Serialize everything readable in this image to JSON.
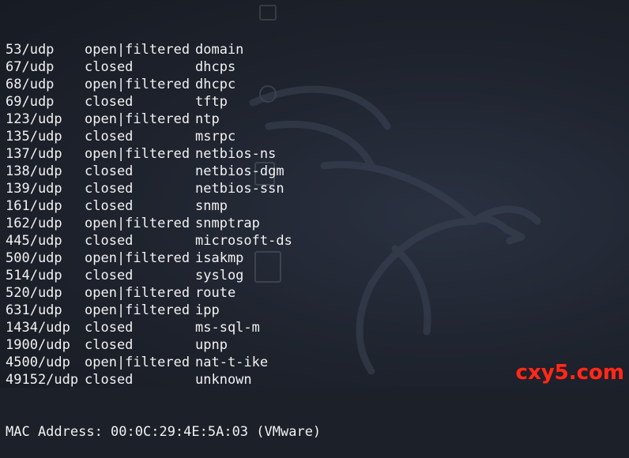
{
  "rows": [
    {
      "port": "53/udp",
      "state": "open|filtered",
      "service": "domain"
    },
    {
      "port": "67/udp",
      "state": "closed",
      "service": "dhcps"
    },
    {
      "port": "68/udp",
      "state": "open|filtered",
      "service": "dhcpc"
    },
    {
      "port": "69/udp",
      "state": "closed",
      "service": "tftp"
    },
    {
      "port": "123/udp",
      "state": "open|filtered",
      "service": "ntp"
    },
    {
      "port": "135/udp",
      "state": "closed",
      "service": "msrpc"
    },
    {
      "port": "137/udp",
      "state": "open|filtered",
      "service": "netbios-ns"
    },
    {
      "port": "138/udp",
      "state": "closed",
      "service": "netbios-dgm"
    },
    {
      "port": "139/udp",
      "state": "closed",
      "service": "netbios-ssn"
    },
    {
      "port": "161/udp",
      "state": "closed",
      "service": "snmp"
    },
    {
      "port": "162/udp",
      "state": "open|filtered",
      "service": "snmptrap"
    },
    {
      "port": "445/udp",
      "state": "closed",
      "service": "microsoft-ds"
    },
    {
      "port": "500/udp",
      "state": "open|filtered",
      "service": "isakmp"
    },
    {
      "port": "514/udp",
      "state": "closed",
      "service": "syslog"
    },
    {
      "port": "520/udp",
      "state": "open|filtered",
      "service": "route"
    },
    {
      "port": "631/udp",
      "state": "open|filtered",
      "service": "ipp"
    },
    {
      "port": "1434/udp",
      "state": "closed",
      "service": "ms-sql-m"
    },
    {
      "port": "1900/udp",
      "state": "closed",
      "service": "upnp"
    },
    {
      "port": "4500/udp",
      "state": "open|filtered",
      "service": "nat-t-ike"
    },
    {
      "port": "49152/udp",
      "state": "closed",
      "service": "unknown"
    }
  ],
  "mac_line": "MAC Address: 00:0C:29:4E:5A:03 (VMware)",
  "watermark": "cxy5.com",
  "colors": {
    "text": "#f2f2f2",
    "background": "#1b2029",
    "watermark": "#ff2a1a"
  },
  "icons": [
    "kali-dragon-icon"
  ]
}
